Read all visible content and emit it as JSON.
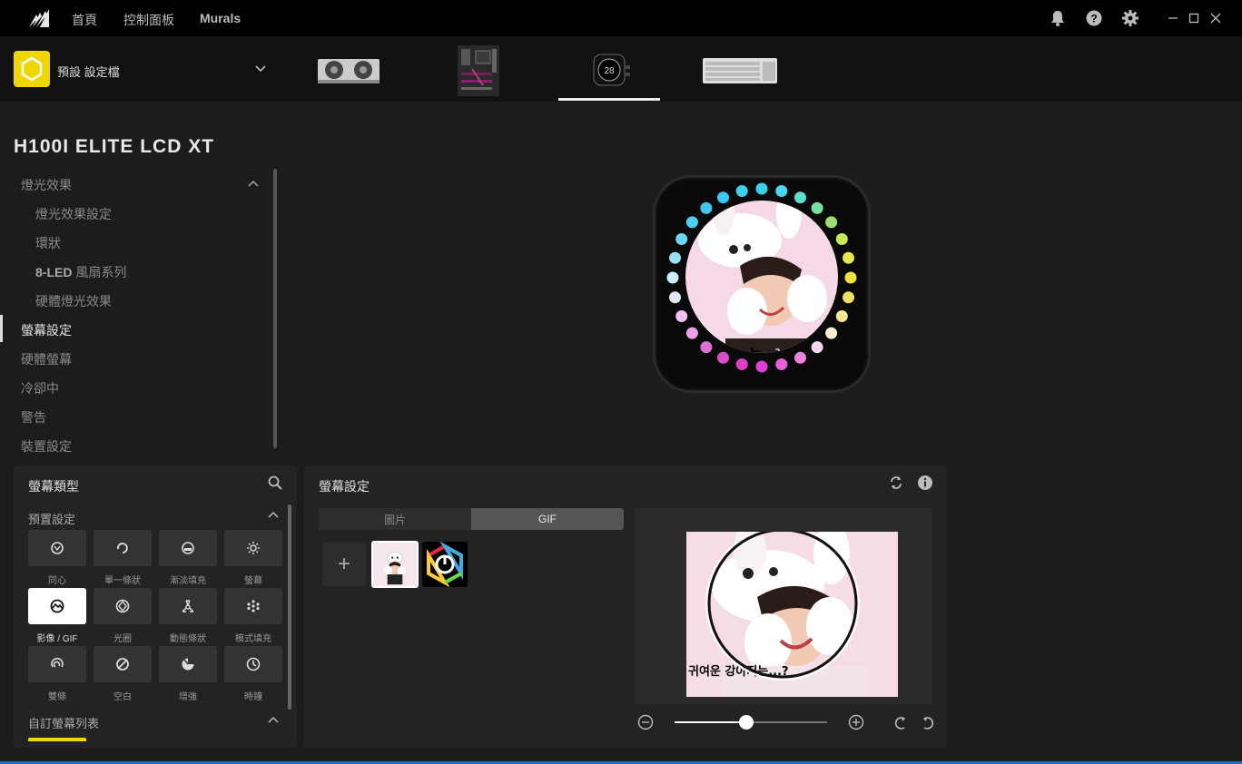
{
  "nav": {
    "home": "首頁",
    "dashboard": "控制面板",
    "murals": "Murals"
  },
  "profile": {
    "label": "預設 設定檔"
  },
  "device": {
    "title": "H100I ELITE LCD XT",
    "lcd_temp": "28"
  },
  "menu": {
    "lighting": "燈光效果",
    "lighting_setup": "燈光效果設定",
    "ring": "環狀",
    "fan_series_prefix": "8-LED",
    "fan_series_suffix": " 風扇系列",
    "hw_lighting": "硬體燈光效果",
    "screen_setup": "螢幕設定",
    "hw_screen": "硬體螢幕",
    "cooling": "冷卻中",
    "alerts": "警告",
    "device_settings": "裝置設定"
  },
  "screen_types": {
    "title": "螢幕類型",
    "presets": "預置設定",
    "custom_list": "自訂螢幕列表",
    "tiles": [
      {
        "label": "同心",
        "icon": "concentric-icon"
      },
      {
        "label": "單一條狀",
        "icon": "single-bar-icon"
      },
      {
        "label": "漸淡填充",
        "icon": "fade-fill-icon"
      },
      {
        "label": "螢幕",
        "icon": "screen-icon"
      },
      {
        "label": "影像 / GIF",
        "icon": "image-gif-icon",
        "selected": true
      },
      {
        "label": "光圈",
        "icon": "aperture-icon"
      },
      {
        "label": "動態條狀",
        "icon": "dynamic-bar-icon"
      },
      {
        "label": "模式填充",
        "icon": "pattern-fill-icon"
      },
      {
        "label": "雙條",
        "icon": "dual-bar-icon"
      },
      {
        "label": "空白",
        "icon": "blank-icon"
      },
      {
        "label": "增強",
        "icon": "boost-icon"
      },
      {
        "label": "時鐘",
        "icon": "clock-icon"
      }
    ]
  },
  "screen_settings": {
    "title": "螢幕設定",
    "tab_image": "圖片",
    "tab_gif": "GIF",
    "add": "+",
    "caption": "는...?",
    "caption2": "귀여운 강아지는...?",
    "zoom_value": 0.47
  },
  "colors": {
    "accent_yellow": "#f2d600",
    "bottom_blue": "#1e6fc2"
  }
}
